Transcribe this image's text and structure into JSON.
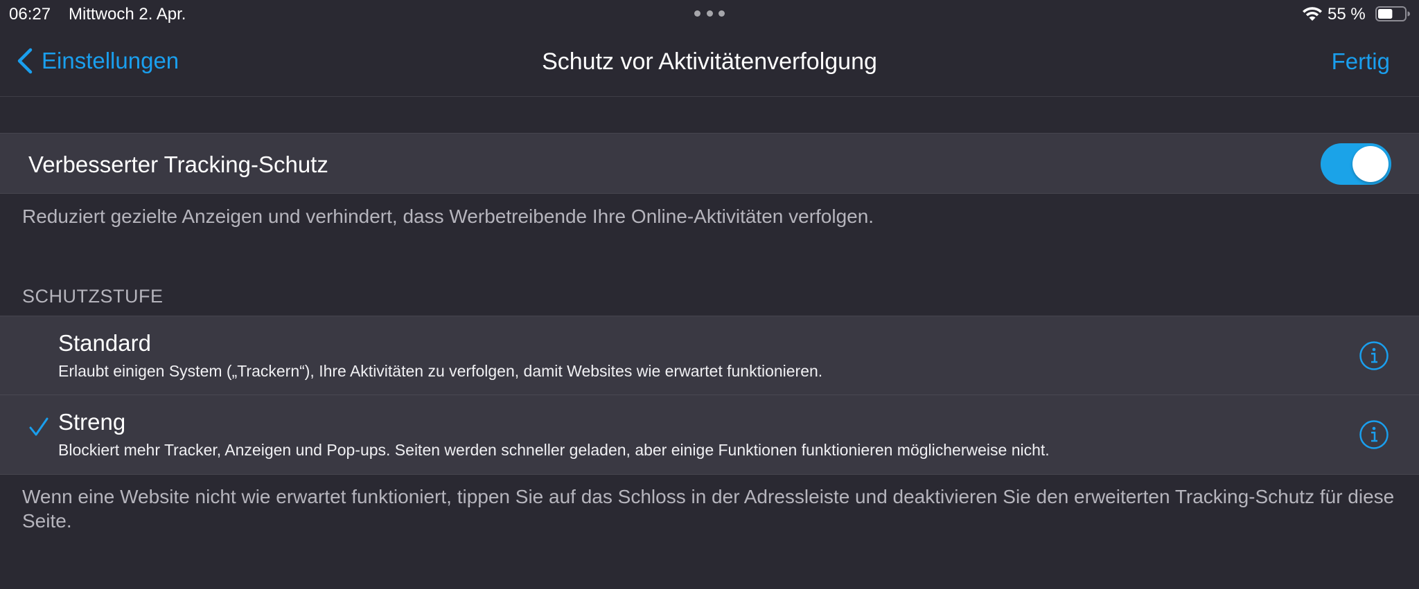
{
  "status_bar": {
    "time": "06:27",
    "date": "Mittwoch 2. Apr.",
    "battery_percent": "55 %",
    "battery_level": 0.55
  },
  "nav": {
    "back_label": "Einstellungen",
    "title": "Schutz vor Aktivitätenverfolgung",
    "done_label": "Fertig"
  },
  "tracking_toggle": {
    "label": "Verbesserter Tracking-Schutz",
    "enabled": true,
    "footer": "Reduziert gezielte Anzeigen und verhindert, dass Werbetreibende Ihre Online-Aktivitäten verfolgen."
  },
  "protection_level": {
    "header": "SCHUTZSTUFE",
    "options": [
      {
        "title": "Standard",
        "description": "Erlaubt einigen System („Trackern“), Ihre Aktivitäten zu verfolgen, damit Websites wie erwartet funktionieren.",
        "selected": false
      },
      {
        "title": "Streng",
        "description": "Blockiert mehr Tracker, Anzeigen und Pop-ups. Seiten werden schneller geladen, aber einige Funktionen funktionieren möglicherweise nicht.",
        "selected": true
      }
    ],
    "footer": "Wenn eine Website nicht wie erwartet funktioniert, tippen Sie auf das Schloss in der Adressleiste und deaktivieren Sie den erweiterten Tracking-Schutz für diese Seite."
  },
  "colors": {
    "background": "#2a2932",
    "cell": "#3a3943",
    "accent": "#1a9fee",
    "toggle_on": "#1ba3e8",
    "secondary_text": "#b6b5bd"
  },
  "icons": {
    "back": "chevron-left-icon",
    "checkmark": "checkmark-icon",
    "info": "info-circle-icon",
    "wifi": "wifi-icon",
    "battery": "battery-icon"
  }
}
